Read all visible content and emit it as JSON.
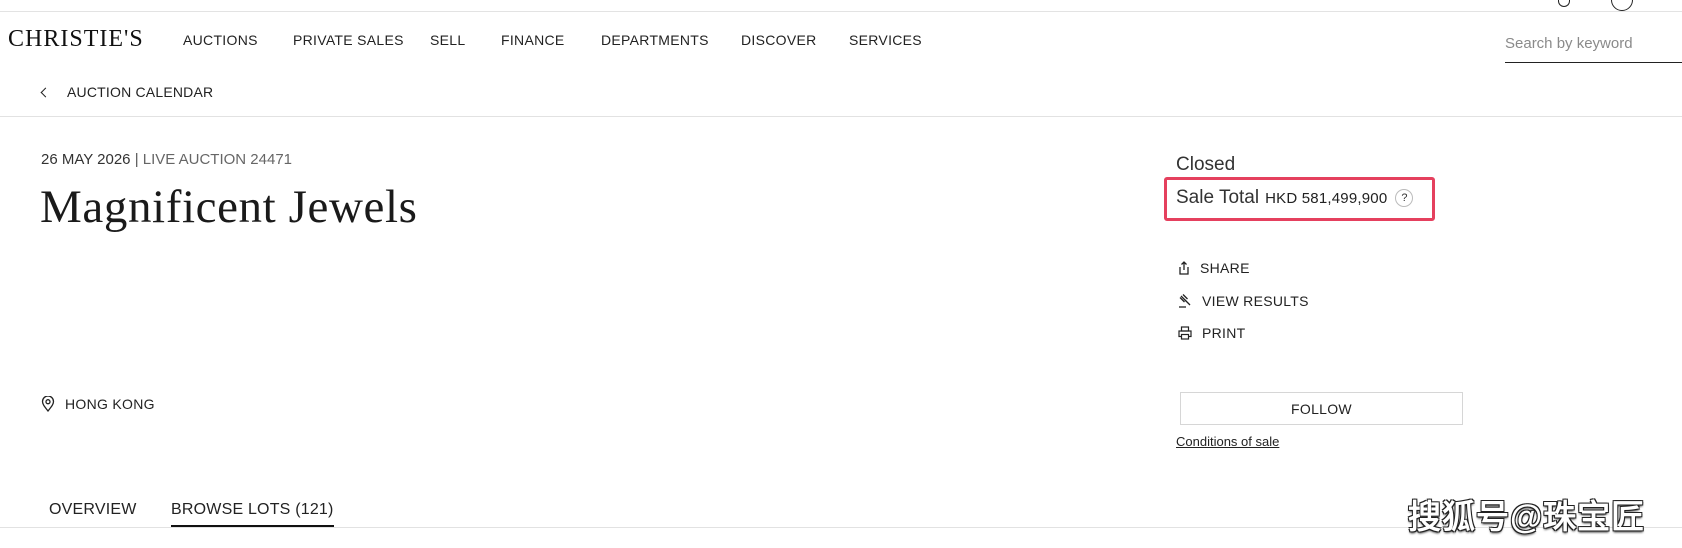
{
  "header": {
    "logo": "CHRISTIE'S",
    "nav": [
      "AUCTIONS",
      "PRIVATE SALES",
      "SELL",
      "FINANCE",
      "DEPARTMENTS",
      "DISCOVER",
      "SERVICES"
    ],
    "search_placeholder": "Search by keyword"
  },
  "breadcrumb": {
    "label": "AUCTION CALENDAR"
  },
  "sale": {
    "date": "26 MAY 2026",
    "separator": "|",
    "auction_type": "LIVE AUCTION 24471",
    "title": "Magnificent Jewels",
    "location": "HONG KONG",
    "status": "Closed",
    "total_label": "Sale Total",
    "total_value": "HKD 581,499,900",
    "help": "?"
  },
  "actions": {
    "share": "SHARE",
    "view_results": "VIEW RESULTS",
    "print": "PRINT"
  },
  "follow_label": "FOLLOW",
  "conditions_label": "Conditions of sale",
  "tabs": [
    {
      "label": "OVERVIEW"
    },
    {
      "label": "BROWSE LOTS (121)"
    }
  ],
  "watermark": "搜狐号@珠宝匠",
  "colors": {
    "highlight": "#e5405e"
  }
}
